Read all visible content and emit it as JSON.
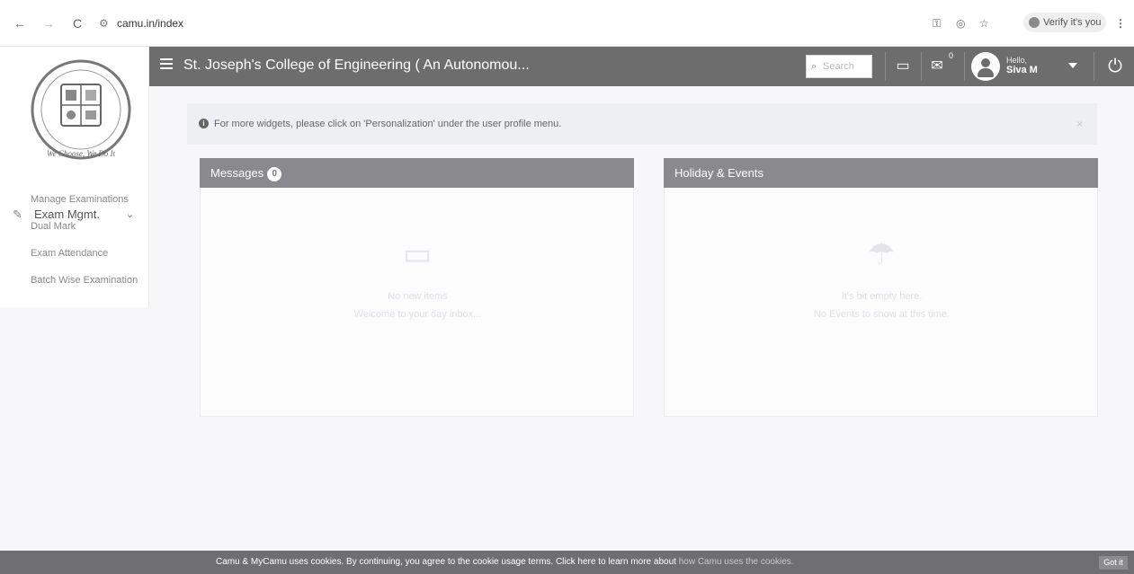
{
  "browser": {
    "url": "camu.in/index",
    "verify_label": "Verify it's you"
  },
  "header": {
    "title": "St. Joseph's College of Engineering ( An Autonomou...",
    "search_placeholder": "Search",
    "message_count": "0",
    "hello": "Hello,",
    "user_name": "Siva M"
  },
  "sidebar": {
    "logo_motto": "We Choose, We Do It",
    "group_label": "Exam Mgmt.",
    "items": [
      "Manage Examinations",
      "Dual Mark",
      "Exam Attendance",
      "Batch Wise Examination"
    ]
  },
  "banner": {
    "text": "For more widgets, please click on 'Personalization' under the user profile menu."
  },
  "messages_panel": {
    "title": "Messages",
    "count": "0",
    "empty_title": "No new items",
    "empty_subtitle": "Welcome to your day inbox..."
  },
  "events_panel": {
    "title": "Holiday & Events",
    "empty_title": "It's bit empty here.",
    "empty_subtitle": "No Events to show at this time."
  },
  "cookie": {
    "text": "Camu & MyCamu uses cookies. By continuing, you agree to the cookie usage terms. Click here to learn more about",
    "link": "how Camu uses the cookies.",
    "button": "Got it"
  }
}
